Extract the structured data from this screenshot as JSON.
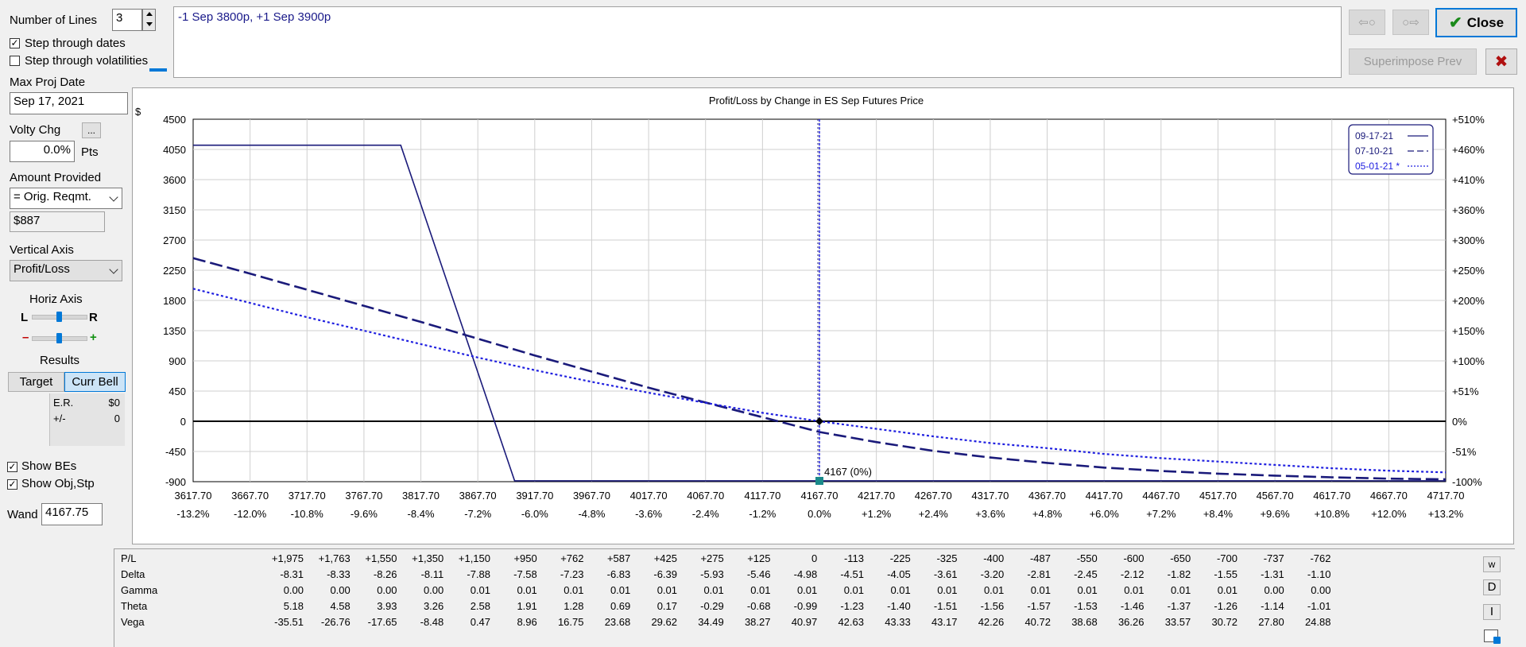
{
  "left": {
    "num_lines_label": "Number of Lines",
    "num_lines_value": "3",
    "step_dates_label": "Step through dates",
    "step_dates_checked": true,
    "step_vols_label": "Step through volatilities",
    "step_vols_checked": false,
    "max_proj_label": "Max Proj Date",
    "max_proj_value": "Sep 17, 2021",
    "volty_label": "Volty Chg",
    "volty_btn": "...",
    "volty_value": "0.0%",
    "volty_unit": "Pts",
    "amount_label": "Amount Provided",
    "amount_select": "= Orig. Reqmt.",
    "amount_value": "$887",
    "vaxis_label": "Vertical Axis",
    "vaxis_select": "Profit/Loss",
    "haxis_label": "Horiz Axis",
    "haxis_l": "L",
    "haxis_r": "R",
    "haxis_minus": "–",
    "haxis_plus": "+",
    "results_label": "Results",
    "target_btn": "Target",
    "currbell_btn": "Curr Bell",
    "er_label": "E.R.",
    "er_value": "$0",
    "pm_label": "+/-",
    "pm_value": "0",
    "show_bes_label": "Show BEs",
    "show_bes_checked": true,
    "show_obj_label": "Show Obj,Stp",
    "show_obj_checked": true,
    "wand_label": "Wand",
    "wand_value": "4167.75"
  },
  "top": {
    "position_text": "-1 Sep 3800p, +1 Sep 3900p",
    "back_arrow": "⇦○",
    "fwd_arrow": "○⇨",
    "close_label": "Close",
    "superimpose_label": "Superimpose Prev",
    "cancel_icon": "✖"
  },
  "chart_data": {
    "type": "line",
    "title": "Profit/Loss by Change in ES Sep Futures Price",
    "ylabel": "$",
    "x": [
      3617.7,
      3667.7,
      3717.7,
      3767.7,
      3817.7,
      3867.7,
      3917.7,
      3967.7,
      4017.7,
      4067.7,
      4117.7,
      4167.7,
      4217.7,
      4267.7,
      4317.7,
      4367.7,
      4417.7,
      4467.7,
      4517.7,
      4567.7,
      4617.7,
      4667.7,
      4717.7
    ],
    "x_tick_labels": [
      "3617.70",
      "3667.70",
      "3717.70",
      "3767.70",
      "3817.70",
      "3867.70",
      "3917.70",
      "3967.70",
      "4017.70",
      "4067.70",
      "4117.70",
      "4167.70",
      "4217.70",
      "4267.70",
      "4317.70",
      "4367.70",
      "4417.70",
      "4467.70",
      "4517.70",
      "4567.70",
      "4617.70",
      "4667.70",
      "4717.70"
    ],
    "x_pct_labels": [
      "-13.2%",
      "-12.0%",
      "-10.8%",
      "-9.6%",
      "-8.4%",
      "-7.2%",
      "-6.0%",
      "-4.8%",
      "-3.6%",
      "-2.4%",
      "-1.2%",
      "0.0%",
      "+1.2%",
      "+2.4%",
      "+3.6%",
      "+4.8%",
      "+6.0%",
      "+7.2%",
      "+8.4%",
      "+9.6%",
      "+10.8%",
      "+12.0%",
      "+13.2%"
    ],
    "xlim": [
      3617.7,
      4717.7
    ],
    "ylim": [
      -900,
      4500
    ],
    "y_ticks": [
      4500,
      4050,
      3600,
      3150,
      2700,
      2250,
      1800,
      1350,
      900,
      450,
      0,
      -450,
      -900
    ],
    "y_tick_labels": [
      "4500",
      "4050",
      "3600",
      "3150",
      "2700",
      "2250",
      "1800",
      "1350",
      "900",
      "450",
      "0",
      "-450",
      "-900"
    ],
    "y_right_labels": [
      "+510%",
      "+460%",
      "+410%",
      "+360%",
      "+300%",
      "+250%",
      "+200%",
      "+150%",
      "+100%",
      "+51%",
      "0%",
      "-51%",
      "-100%"
    ],
    "grid": true,
    "legend_position": "top-right",
    "cursor_x": 4167.7,
    "cursor_label": "4167 (0%)",
    "series": [
      {
        "name": "09-17-21",
        "style": "solid",
        "color": "#1a1a7a",
        "points": [
          [
            3617.7,
            4113
          ],
          [
            3800,
            4113
          ],
          [
            3900,
            -887
          ],
          [
            4717.7,
            -887
          ]
        ]
      },
      {
        "name": "07-10-21",
        "style": "dashed",
        "color": "#1a1a7a",
        "points": [
          [
            3617.7,
            2430
          ],
          [
            3667.7,
            2200
          ],
          [
            3717.7,
            1960
          ],
          [
            3767.7,
            1720
          ],
          [
            3817.7,
            1480
          ],
          [
            3867.7,
            1230
          ],
          [
            3917.7,
            980
          ],
          [
            3967.7,
            740
          ],
          [
            4017.7,
            500
          ],
          [
            4067.7,
            280
          ],
          [
            4117.7,
            60
          ],
          [
            4167.7,
            -160
          ],
          [
            4217.7,
            -310
          ],
          [
            4267.7,
            -440
          ],
          [
            4317.7,
            -540
          ],
          [
            4367.7,
            -620
          ],
          [
            4417.7,
            -690
          ],
          [
            4467.7,
            -740
          ],
          [
            4517.7,
            -780
          ],
          [
            4567.7,
            -810
          ],
          [
            4617.7,
            -835
          ],
          [
            4667.7,
            -855
          ],
          [
            4717.7,
            -865
          ]
        ]
      },
      {
        "name": "05-01-21 *",
        "style": "dotted",
        "color": "#2020e0",
        "points": [
          [
            3617.7,
            1975
          ],
          [
            3667.7,
            1763
          ],
          [
            3717.7,
            1550
          ],
          [
            3767.7,
            1350
          ],
          [
            3817.7,
            1150
          ],
          [
            3867.7,
            950
          ],
          [
            3917.7,
            762
          ],
          [
            3967.7,
            587
          ],
          [
            4017.7,
            425
          ],
          [
            4067.7,
            275
          ],
          [
            4117.7,
            125
          ],
          [
            4167.7,
            0
          ],
          [
            4217.7,
            -113
          ],
          [
            4267.7,
            -225
          ],
          [
            4317.7,
            -325
          ],
          [
            4367.7,
            -400
          ],
          [
            4417.7,
            -487
          ],
          [
            4467.7,
            -550
          ],
          [
            4517.7,
            -600
          ],
          [
            4567.7,
            -650
          ],
          [
            4617.7,
            -700
          ],
          [
            4667.7,
            -737
          ],
          [
            4717.7,
            -762
          ]
        ]
      }
    ]
  },
  "greeks": {
    "rows": [
      {
        "label": "P/L",
        "values": [
          "+1,975",
          "+1,763",
          "+1,550",
          "+1,350",
          "+1,150",
          "+950",
          "+762",
          "+587",
          "+425",
          "+275",
          "+125",
          "0",
          "-113",
          "-225",
          "-325",
          "-400",
          "-487",
          "-550",
          "-600",
          "-650",
          "-700",
          "-737",
          "-762"
        ]
      },
      {
        "label": "Delta",
        "values": [
          "-8.31",
          "-8.33",
          "-8.26",
          "-8.11",
          "-7.88",
          "-7.58",
          "-7.23",
          "-6.83",
          "-6.39",
          "-5.93",
          "-5.46",
          "-4.98",
          "-4.51",
          "-4.05",
          "-3.61",
          "-3.20",
          "-2.81",
          "-2.45",
          "-2.12",
          "-1.82",
          "-1.55",
          "-1.31",
          "-1.10"
        ]
      },
      {
        "label": "Gamma",
        "values": [
          "0.00",
          "0.00",
          "0.00",
          "0.00",
          "0.01",
          "0.01",
          "0.01",
          "0.01",
          "0.01",
          "0.01",
          "0.01",
          "0.01",
          "0.01",
          "0.01",
          "0.01",
          "0.01",
          "0.01",
          "0.01",
          "0.01",
          "0.01",
          "0.01",
          "0.00",
          "0.00"
        ]
      },
      {
        "label": "Theta",
        "values": [
          "5.18",
          "4.58",
          "3.93",
          "3.26",
          "2.58",
          "1.91",
          "1.28",
          "0.69",
          "0.17",
          "-0.29",
          "-0.68",
          "-0.99",
          "-1.23",
          "-1.40",
          "-1.51",
          "-1.56",
          "-1.57",
          "-1.53",
          "-1.46",
          "-1.37",
          "-1.26",
          "-1.14",
          "-1.01"
        ]
      },
      {
        "label": "Vega",
        "values": [
          "-35.51",
          "-26.76",
          "-17.65",
          "-8.48",
          "0.47",
          "8.96",
          "16.75",
          "23.68",
          "29.62",
          "34.49",
          "38.27",
          "40.97",
          "42.63",
          "43.33",
          "43.17",
          "42.26",
          "40.72",
          "38.68",
          "36.26",
          "33.57",
          "30.72",
          "27.80",
          "24.88"
        ]
      }
    ],
    "side_buttons": [
      "w",
      "D",
      "I"
    ]
  }
}
